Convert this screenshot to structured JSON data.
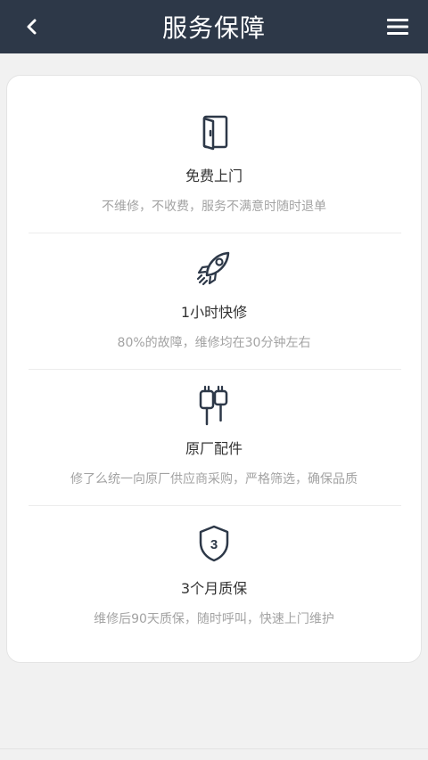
{
  "header": {
    "title": "服务保障",
    "back_icon": "chevron-left-icon",
    "menu_icon": "hamburger-menu-icon"
  },
  "colors": {
    "header_bg": "#2d3848",
    "page_bg": "#f1f1f1",
    "icon_stroke": "#2d3848",
    "title_text": "#333333",
    "desc_text": "#a3a3a3"
  },
  "features": [
    {
      "icon": "door-icon",
      "title": "免费上门",
      "desc": "不维修，不收费，服务不满意时随时退单"
    },
    {
      "icon": "rocket-icon",
      "title": "1小时快修",
      "desc": "80%的故障，维修均在30分钟左右"
    },
    {
      "icon": "connector-cables-icon",
      "title": "原厂配件",
      "desc": "修了么统一向原厂供应商采购，严格筛选，确保品质"
    },
    {
      "icon": "shield-3-icon",
      "title": "3个月质保",
      "desc": "维修后90天质保，随时呼叫，快速上门维护"
    }
  ]
}
